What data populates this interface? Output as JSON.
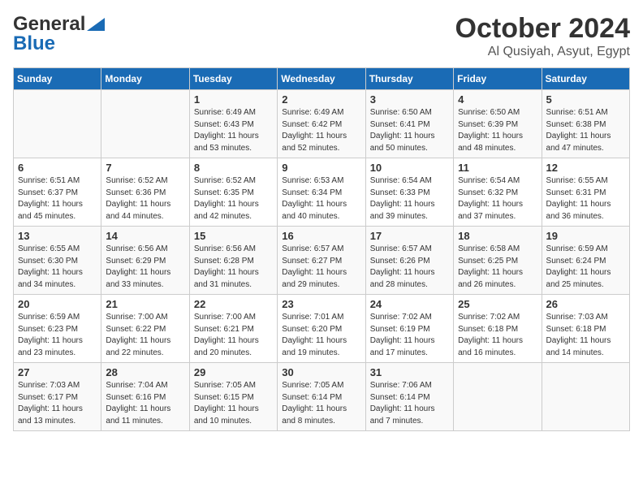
{
  "logo": {
    "general": "General",
    "blue": "Blue"
  },
  "title": "October 2024",
  "location": "Al Qusiyah, Asyut, Egypt",
  "days_header": [
    "Sunday",
    "Monday",
    "Tuesday",
    "Wednesday",
    "Thursday",
    "Friday",
    "Saturday"
  ],
  "weeks": [
    [
      {
        "day": "",
        "sunrise": "",
        "sunset": "",
        "daylight": ""
      },
      {
        "day": "",
        "sunrise": "",
        "sunset": "",
        "daylight": ""
      },
      {
        "day": "1",
        "sunrise": "Sunrise: 6:49 AM",
        "sunset": "Sunset: 6:43 PM",
        "daylight": "Daylight: 11 hours and 53 minutes."
      },
      {
        "day": "2",
        "sunrise": "Sunrise: 6:49 AM",
        "sunset": "Sunset: 6:42 PM",
        "daylight": "Daylight: 11 hours and 52 minutes."
      },
      {
        "day": "3",
        "sunrise": "Sunrise: 6:50 AM",
        "sunset": "Sunset: 6:41 PM",
        "daylight": "Daylight: 11 hours and 50 minutes."
      },
      {
        "day": "4",
        "sunrise": "Sunrise: 6:50 AM",
        "sunset": "Sunset: 6:39 PM",
        "daylight": "Daylight: 11 hours and 48 minutes."
      },
      {
        "day": "5",
        "sunrise": "Sunrise: 6:51 AM",
        "sunset": "Sunset: 6:38 PM",
        "daylight": "Daylight: 11 hours and 47 minutes."
      }
    ],
    [
      {
        "day": "6",
        "sunrise": "Sunrise: 6:51 AM",
        "sunset": "Sunset: 6:37 PM",
        "daylight": "Daylight: 11 hours and 45 minutes."
      },
      {
        "day": "7",
        "sunrise": "Sunrise: 6:52 AM",
        "sunset": "Sunset: 6:36 PM",
        "daylight": "Daylight: 11 hours and 44 minutes."
      },
      {
        "day": "8",
        "sunrise": "Sunrise: 6:52 AM",
        "sunset": "Sunset: 6:35 PM",
        "daylight": "Daylight: 11 hours and 42 minutes."
      },
      {
        "day": "9",
        "sunrise": "Sunrise: 6:53 AM",
        "sunset": "Sunset: 6:34 PM",
        "daylight": "Daylight: 11 hours and 40 minutes."
      },
      {
        "day": "10",
        "sunrise": "Sunrise: 6:54 AM",
        "sunset": "Sunset: 6:33 PM",
        "daylight": "Daylight: 11 hours and 39 minutes."
      },
      {
        "day": "11",
        "sunrise": "Sunrise: 6:54 AM",
        "sunset": "Sunset: 6:32 PM",
        "daylight": "Daylight: 11 hours and 37 minutes."
      },
      {
        "day": "12",
        "sunrise": "Sunrise: 6:55 AM",
        "sunset": "Sunset: 6:31 PM",
        "daylight": "Daylight: 11 hours and 36 minutes."
      }
    ],
    [
      {
        "day": "13",
        "sunrise": "Sunrise: 6:55 AM",
        "sunset": "Sunset: 6:30 PM",
        "daylight": "Daylight: 11 hours and 34 minutes."
      },
      {
        "day": "14",
        "sunrise": "Sunrise: 6:56 AM",
        "sunset": "Sunset: 6:29 PM",
        "daylight": "Daylight: 11 hours and 33 minutes."
      },
      {
        "day": "15",
        "sunrise": "Sunrise: 6:56 AM",
        "sunset": "Sunset: 6:28 PM",
        "daylight": "Daylight: 11 hours and 31 minutes."
      },
      {
        "day": "16",
        "sunrise": "Sunrise: 6:57 AM",
        "sunset": "Sunset: 6:27 PM",
        "daylight": "Daylight: 11 hours and 29 minutes."
      },
      {
        "day": "17",
        "sunrise": "Sunrise: 6:57 AM",
        "sunset": "Sunset: 6:26 PM",
        "daylight": "Daylight: 11 hours and 28 minutes."
      },
      {
        "day": "18",
        "sunrise": "Sunrise: 6:58 AM",
        "sunset": "Sunset: 6:25 PM",
        "daylight": "Daylight: 11 hours and 26 minutes."
      },
      {
        "day": "19",
        "sunrise": "Sunrise: 6:59 AM",
        "sunset": "Sunset: 6:24 PM",
        "daylight": "Daylight: 11 hours and 25 minutes."
      }
    ],
    [
      {
        "day": "20",
        "sunrise": "Sunrise: 6:59 AM",
        "sunset": "Sunset: 6:23 PM",
        "daylight": "Daylight: 11 hours and 23 minutes."
      },
      {
        "day": "21",
        "sunrise": "Sunrise: 7:00 AM",
        "sunset": "Sunset: 6:22 PM",
        "daylight": "Daylight: 11 hours and 22 minutes."
      },
      {
        "day": "22",
        "sunrise": "Sunrise: 7:00 AM",
        "sunset": "Sunset: 6:21 PM",
        "daylight": "Daylight: 11 hours and 20 minutes."
      },
      {
        "day": "23",
        "sunrise": "Sunrise: 7:01 AM",
        "sunset": "Sunset: 6:20 PM",
        "daylight": "Daylight: 11 hours and 19 minutes."
      },
      {
        "day": "24",
        "sunrise": "Sunrise: 7:02 AM",
        "sunset": "Sunset: 6:19 PM",
        "daylight": "Daylight: 11 hours and 17 minutes."
      },
      {
        "day": "25",
        "sunrise": "Sunrise: 7:02 AM",
        "sunset": "Sunset: 6:18 PM",
        "daylight": "Daylight: 11 hours and 16 minutes."
      },
      {
        "day": "26",
        "sunrise": "Sunrise: 7:03 AM",
        "sunset": "Sunset: 6:18 PM",
        "daylight": "Daylight: 11 hours and 14 minutes."
      }
    ],
    [
      {
        "day": "27",
        "sunrise": "Sunrise: 7:03 AM",
        "sunset": "Sunset: 6:17 PM",
        "daylight": "Daylight: 11 hours and 13 minutes."
      },
      {
        "day": "28",
        "sunrise": "Sunrise: 7:04 AM",
        "sunset": "Sunset: 6:16 PM",
        "daylight": "Daylight: 11 hours and 11 minutes."
      },
      {
        "day": "29",
        "sunrise": "Sunrise: 7:05 AM",
        "sunset": "Sunset: 6:15 PM",
        "daylight": "Daylight: 11 hours and 10 minutes."
      },
      {
        "day": "30",
        "sunrise": "Sunrise: 7:05 AM",
        "sunset": "Sunset: 6:14 PM",
        "daylight": "Daylight: 11 hours and 8 minutes."
      },
      {
        "day": "31",
        "sunrise": "Sunrise: 7:06 AM",
        "sunset": "Sunset: 6:14 PM",
        "daylight": "Daylight: 11 hours and 7 minutes."
      },
      {
        "day": "",
        "sunrise": "",
        "sunset": "",
        "daylight": ""
      },
      {
        "day": "",
        "sunrise": "",
        "sunset": "",
        "daylight": ""
      }
    ]
  ]
}
